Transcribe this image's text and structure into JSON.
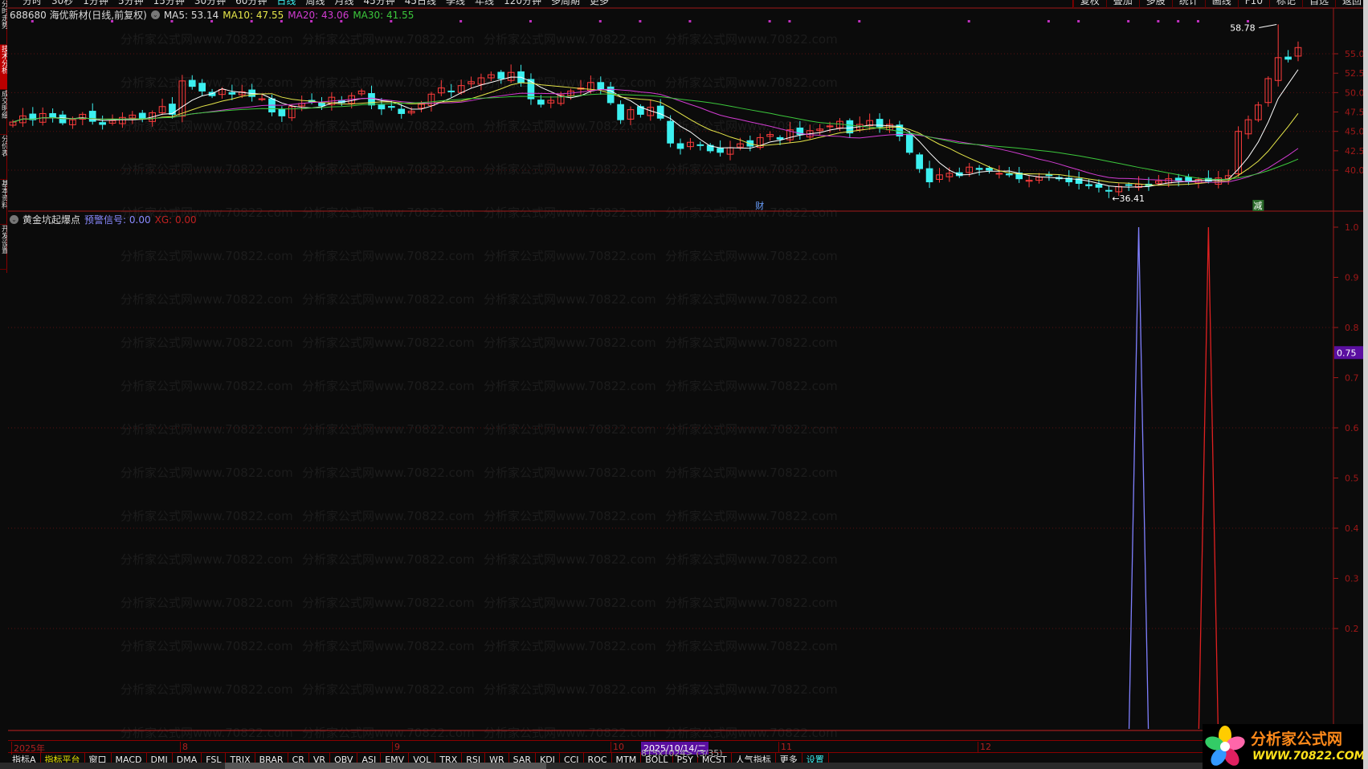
{
  "toolbar": {
    "periods": [
      "分时",
      "30秒",
      "1分钟",
      "5分钟",
      "15分钟",
      "30分钟",
      "60分钟",
      "日线",
      "周线",
      "月线",
      "45分钟",
      "45日线",
      "季线",
      "年线",
      "120分钟",
      "多周期",
      "更多"
    ],
    "active": "日线",
    "right": [
      "复权",
      "叠加",
      "多股",
      "统计",
      "画线",
      "F10",
      "标记",
      "自选",
      "返回"
    ]
  },
  "left_tabs": [
    "分时走势",
    "技术分析",
    "成交明细",
    "分价表",
    "基本资料",
    "开发设置"
  ],
  "title": {
    "stock": "688680 海优新材(日线,前复权)",
    "ma5": "MA5: 53.14",
    "ma10": "MA10: 47.55",
    "ma20": "MA20: 43.06",
    "ma30": "MA30: 41.55"
  },
  "indicator": {
    "name": "黄金坑起爆点",
    "signal_label": "预警信号: 0.00",
    "xg_label": "XG: 0.00"
  },
  "colors": {
    "up": "#ff3c3c",
    "down": "#3cf0f0",
    "ma5": "#ffffff",
    "ma10": "#e6e64a",
    "ma20": "#d23cd2",
    "ma30": "#3cc83c",
    "signal": "#8080ff",
    "xg": "#e02020",
    "axis": "#a01818"
  },
  "price_axis": {
    "min": 34,
    "max": 58.78,
    "ticks": [
      "55.0",
      "52.5",
      "50.0",
      "47.5",
      "45.0",
      "42.5",
      "40.0"
    ]
  },
  "indicator_axis": {
    "ticks": [
      "1.0",
      "0.9",
      "0.8",
      "0.7",
      "0.6",
      "0.5",
      "0.4",
      "0.3",
      "0.2"
    ],
    "current": "0.75"
  },
  "closes": [
    46.2,
    47.0,
    46.5,
    47.3,
    46.8,
    46.1,
    46.5,
    47.2,
    46.3,
    45.9,
    46.4,
    46.8,
    47.1,
    46.6,
    47.4,
    48.2,
    47.2,
    51.5,
    50.8,
    50.2,
    49.6,
    50.4,
    49.8,
    50.1,
    49.5,
    49.2,
    47.5,
    47.0,
    48.2,
    48.6,
    48.8,
    48.3,
    49.4,
    48.7,
    49.6,
    50.2,
    48.4,
    47.9,
    48.1,
    47.3,
    47.6,
    48.5,
    49.8,
    50.6,
    50.1,
    50.9,
    51.4,
    51.9,
    52.3,
    51.8,
    52.6,
    51.3,
    49.2,
    48.5,
    49.0,
    49.7,
    50.2,
    50.6,
    51.3,
    50.4,
    48.7,
    46.5,
    47.8,
    47.2,
    48.1,
    46.7,
    43.5,
    42.8,
    43.6,
    43.2,
    42.5,
    42.3,
    42.9,
    43.4,
    43.1,
    44.2,
    44.6,
    44.0,
    45.2,
    44.6,
    45.1,
    45.3,
    45.7,
    46.3,
    44.8,
    45.9,
    46.4,
    45.6,
    45.9,
    44.4,
    42.3,
    40.2,
    38.5,
    39.4,
    39.6,
    39.3,
    40.4,
    40.1,
    40.0,
    39.6,
    39.4,
    38.9,
    38.7,
    39.1,
    39.3,
    38.9,
    38.5,
    38.3,
    38.0,
    37.8,
    37.3,
    37.9,
    38.1,
    38.2,
    38.0,
    38.6,
    38.9,
    38.7,
    38.5,
    38.8,
    38.6,
    39.0,
    39.3,
    45.0,
    46.5,
    48.4,
    51.8,
    54.5,
    54.3,
    55.8
  ],
  "high_label": {
    "text": "58.78",
    "index": 127,
    "value": 58.78
  },
  "low_label": {
    "text": "36.41",
    "index": 110,
    "value": 36.41
  },
  "events": [
    {
      "text": "财",
      "index": 75
    },
    {
      "text": "减",
      "index": 125
    }
  ],
  "signal_index": 113,
  "xg_index": 120,
  "marker_indices": [
    2,
    10,
    16,
    20,
    24,
    27,
    30,
    33,
    38,
    45,
    52,
    59,
    63,
    68,
    76,
    78,
    85,
    96,
    104,
    107,
    112,
    115,
    117,
    119,
    124
  ],
  "dates": [
    "2025年",
    "8",
    "9",
    "10",
    "2025/10/14/二",
    "11",
    "12"
  ],
  "bottom_tabs": [
    "指标A",
    "指标平台",
    "窗口",
    "MACD",
    "DMI",
    "DMA",
    "FSL",
    "TRIX",
    "BRAR",
    "CR",
    "VR",
    "OBV",
    "ASI",
    "EMV",
    "VOL",
    "TRX",
    "RSI",
    "WR",
    "SAR",
    "KDJ",
    "CCI",
    "ROC",
    "MTM",
    "BOLL",
    "PSY",
    "MCST",
    "人气指标",
    "更多",
    "设置"
  ],
  "overlay": "815x1024> (3/35)",
  "watermark": "分析家公式网www.70822.com",
  "logo": {
    "name": "分析家公式网",
    "url": "WWW.70822.COM"
  }
}
